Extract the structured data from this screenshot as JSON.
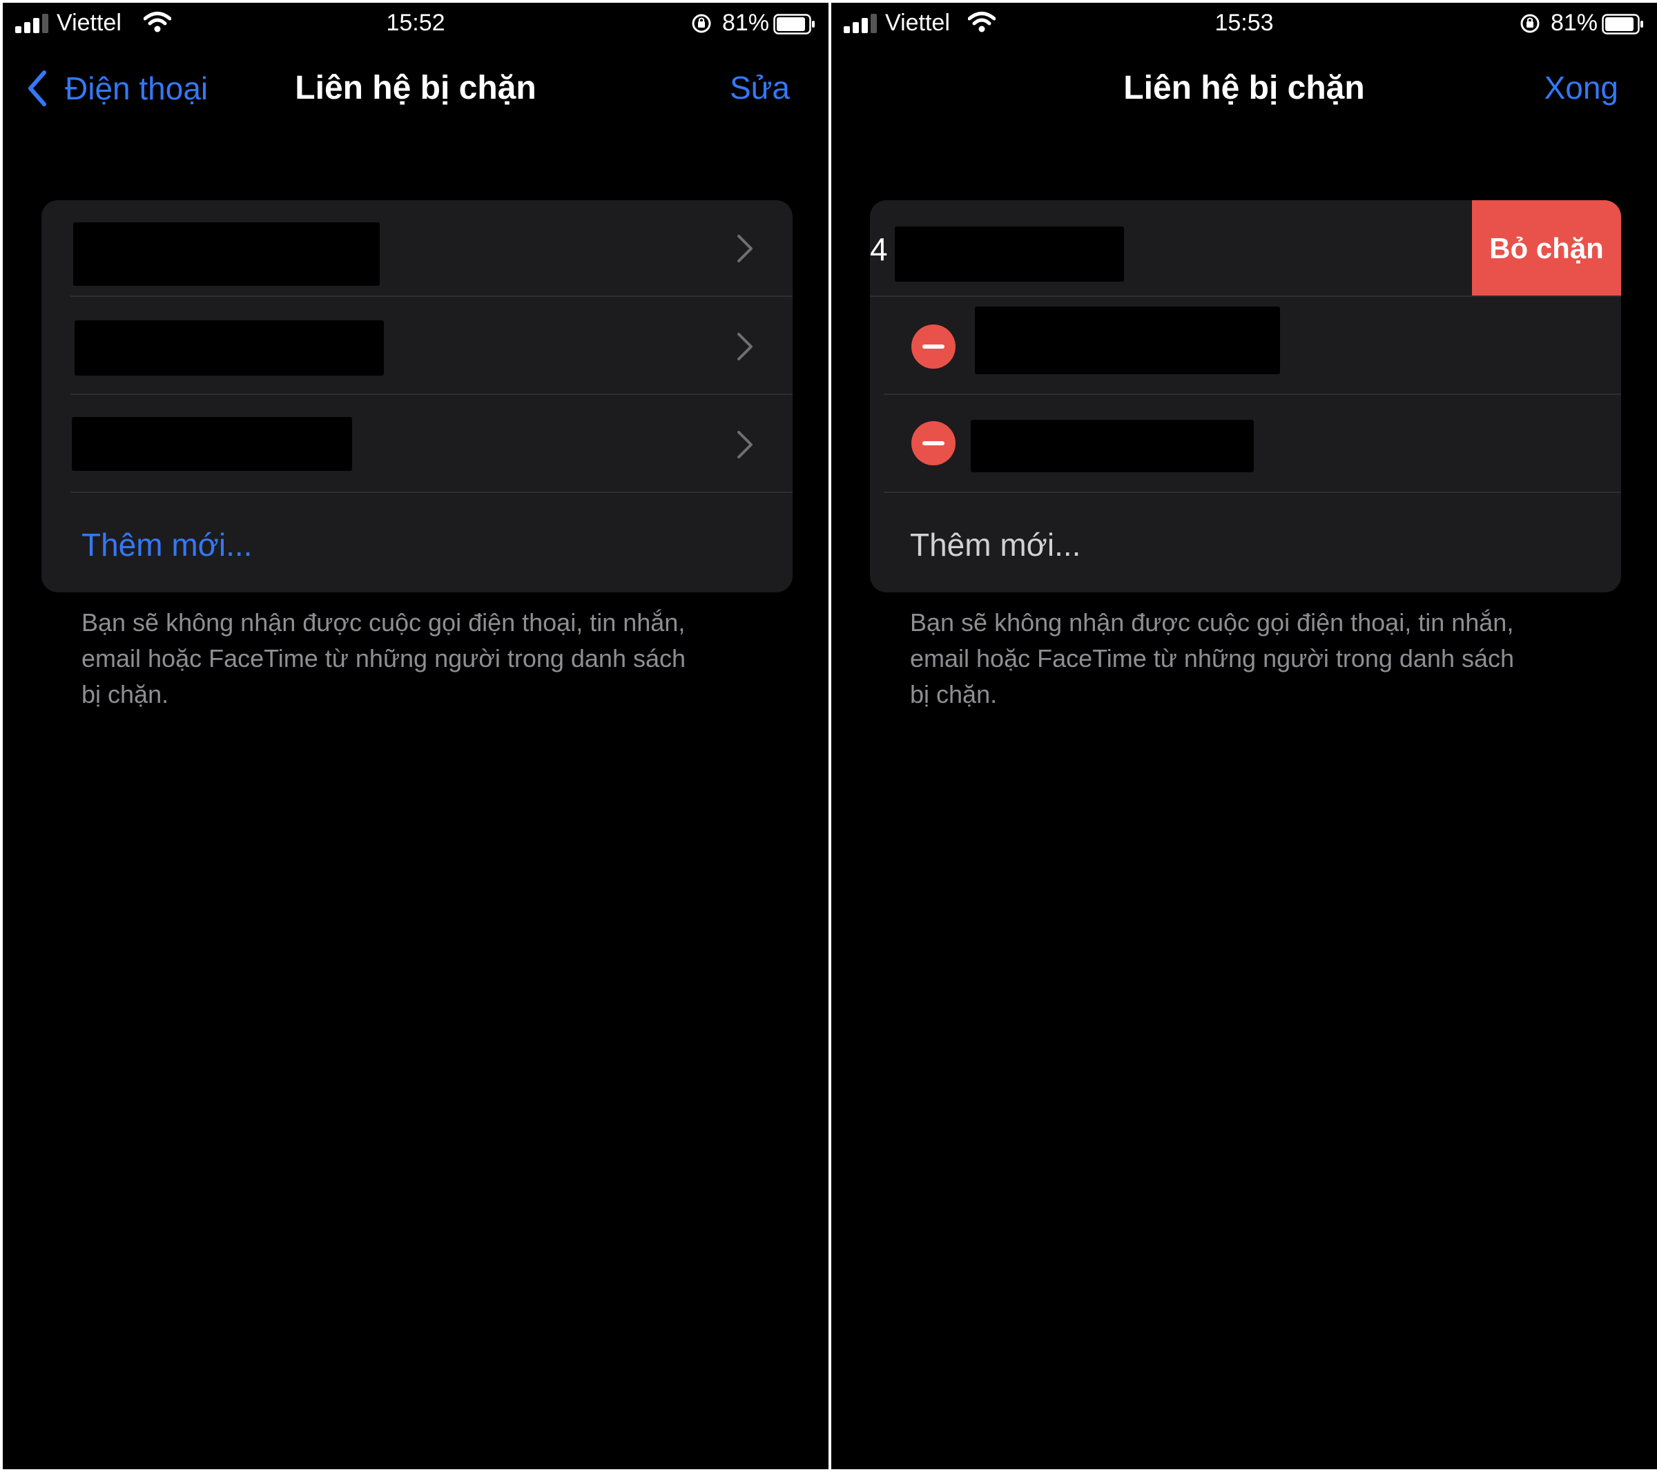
{
  "colors": {
    "accent": "#3478f6",
    "destructive": "#e9524a",
    "background": "#000000",
    "cell": "#1c1c1e",
    "secondary_text": "#8e8e93"
  },
  "left": {
    "status": {
      "carrier": "Viettel",
      "time": "15:52",
      "battery": "81%"
    },
    "nav": {
      "back_label": "Điện thoại",
      "title": "Liên hệ bị chặn",
      "right_label": "Sửa"
    },
    "add_label": "Thêm mới...",
    "footnote": [
      "Bạn sẽ không nhận được cuộc gọi điện thoại, tin nhắn,",
      "email hoặc FaceTime từ những người trong danh sách",
      "bị chặn."
    ]
  },
  "right": {
    "status": {
      "carrier": "Viettel",
      "time": "15:53",
      "battery": "81%"
    },
    "nav": {
      "title": "Liên hệ bị chặn",
      "right_label": "Xong"
    },
    "swipe_row_prefix": "4",
    "unblock_label": "Bỏ chặn",
    "add_label": "Thêm mới...",
    "footnote": [
      "Bạn sẽ không nhận được cuộc gọi điện thoại, tin nhắn,",
      "email hoặc FaceTime từ những người trong danh sách",
      "bị chặn."
    ]
  },
  "icons": {
    "signal": "cellular-signal-icon",
    "wifi": "wifi-icon",
    "lock": "orientation-lock-icon",
    "battery": "battery-icon",
    "back": "chevron-left-icon",
    "row": "chevron-right-icon",
    "delete": "minus-circle-icon"
  }
}
